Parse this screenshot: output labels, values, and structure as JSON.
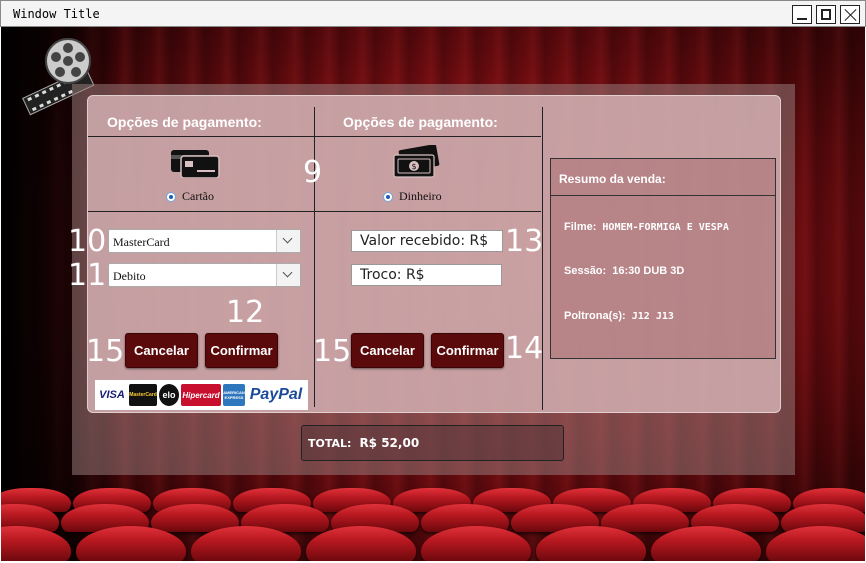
{
  "window": {
    "title": "Window Title"
  },
  "payment": {
    "card": {
      "heading": "Opções de pagamento:",
      "radio_label": "Cartão",
      "brand_select": "MasterCard",
      "type_select": "Debito",
      "cancel_label": "Cancelar",
      "confirm_label": "Confirmar",
      "card_brands": [
        "VISA",
        "MasterCard",
        "elo",
        "Hipercard",
        "AMERICAN EXPRESS",
        "PayPal"
      ]
    },
    "cash": {
      "heading": "Opções de pagamento:",
      "radio_label": "Dinheiro",
      "received_field": "Valor recebido: R$",
      "change_field": "Troco: R$",
      "cancel_label": "Cancelar",
      "confirm_label": "Confirmar"
    }
  },
  "annotations": {
    "n9": "9",
    "n10": "10",
    "n11": "11",
    "n12": "12",
    "n13": "13",
    "n14": "14",
    "n15a": "15",
    "n15b": "15"
  },
  "summary": {
    "title": "Resumo da venda:",
    "film_label": "Filme:",
    "film_value": "HOMEM-FORMIGA E VESPA",
    "session_label": "Sessão:",
    "session_value": "16:30  DUB  3D",
    "seats_label": "Poltrona(s):",
    "seats_value": "J12  J13"
  },
  "total": {
    "label": "TOTAL:",
    "value": "R$ 52,00"
  },
  "colors": {
    "button": "#5b0a0b",
    "accent_radio": "#1b5fb6"
  }
}
